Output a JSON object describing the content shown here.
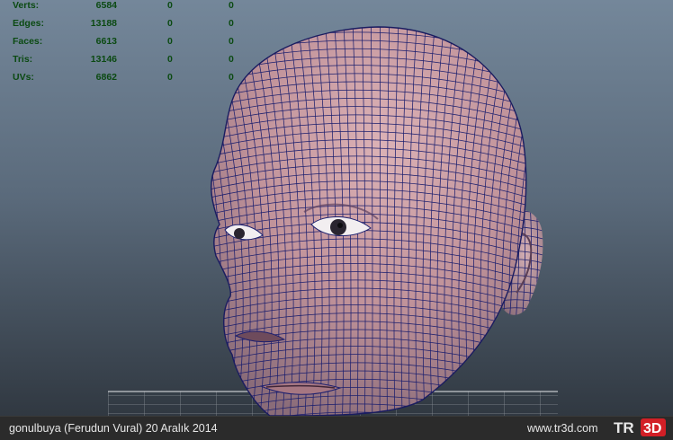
{
  "stats": [
    {
      "label": "Verts:",
      "v1": "6584",
      "v2": "0",
      "v3": "0"
    },
    {
      "label": "Edges:",
      "v1": "13188",
      "v2": "0",
      "v3": "0"
    },
    {
      "label": "Faces:",
      "v1": "6613",
      "v2": "0",
      "v3": "0"
    },
    {
      "label": "Tris:",
      "v1": "13146",
      "v2": "0",
      "v3": "0"
    },
    {
      "label": "UVs:",
      "v1": "6862",
      "v2": "0",
      "v3": "0"
    }
  ],
  "footer": {
    "credit": "gonulbuya (Ferudun Vural)  20 Aralık 2014",
    "site": "www.tr3d.com",
    "logo_text": "TR3D"
  },
  "colors": {
    "hud_text": "#0b4a12",
    "wire": "#1c1f6e",
    "skin": "#c4959a",
    "logo_red": "#d21f26"
  }
}
